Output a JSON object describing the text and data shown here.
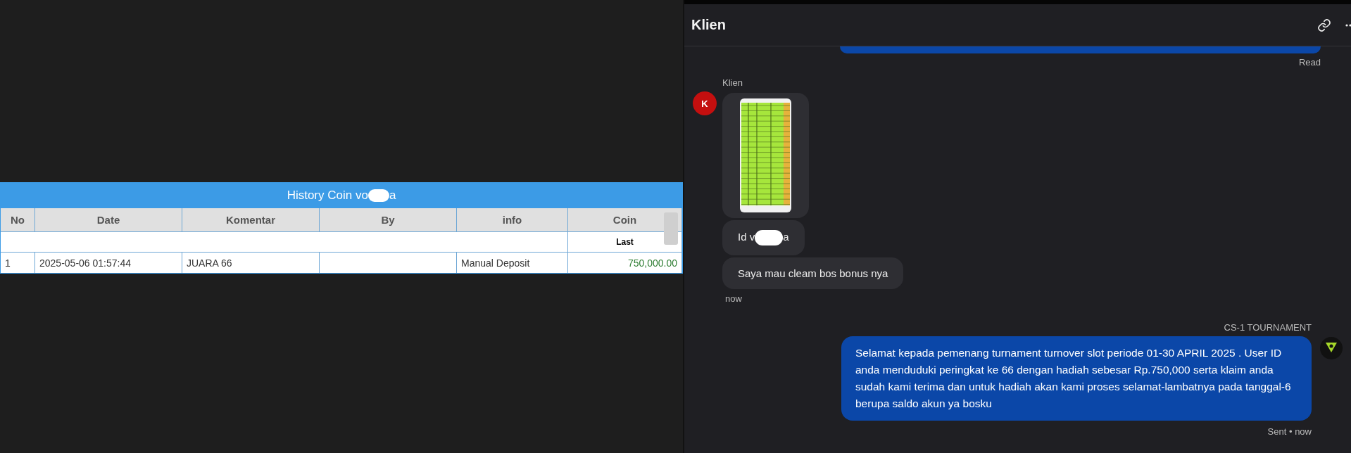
{
  "history_table": {
    "title": {
      "before": "History Coin vo",
      "after": "a"
    },
    "columns": [
      "No",
      "Date",
      "Komentar",
      "By",
      "info",
      "Coin"
    ],
    "subheader": "Last",
    "rows": [
      {
        "cells": [
          "1",
          "2025-05-06 01:57:44",
          "JUARA 66",
          "",
          "Manual Deposit",
          "750,000.00"
        ]
      }
    ]
  },
  "chat": {
    "title": "Klien",
    "previous": {
      "status": "Read"
    },
    "incoming": {
      "sender": "Klien",
      "avatar": "K",
      "messages": [
        {
          "kind": "picture"
        },
        {
          "kind": "redacted",
          "before": "Id v",
          "after": "a"
        },
        {
          "kind": "text",
          "text": "Saya mau cleam bos bonus nya"
        }
      ],
      "time": "now"
    },
    "outgoing": {
      "sender": "CS-1 TOURNAMENT",
      "text": "Selamat kepada pemenang turnament turnover slot periode 01-30 APRIL 2025 . User ID anda menduduki peringkat ke 66 dengan hadiah sebesar Rp.750,000 serta klaim anda sudah kami terima dan untuk hadiah akan kami proses selamat-lambatnya pada tanggal-6 berupa saldo akun ya bosku",
      "status": "Sent",
      "separator": "•",
      "time": "now"
    }
  }
}
